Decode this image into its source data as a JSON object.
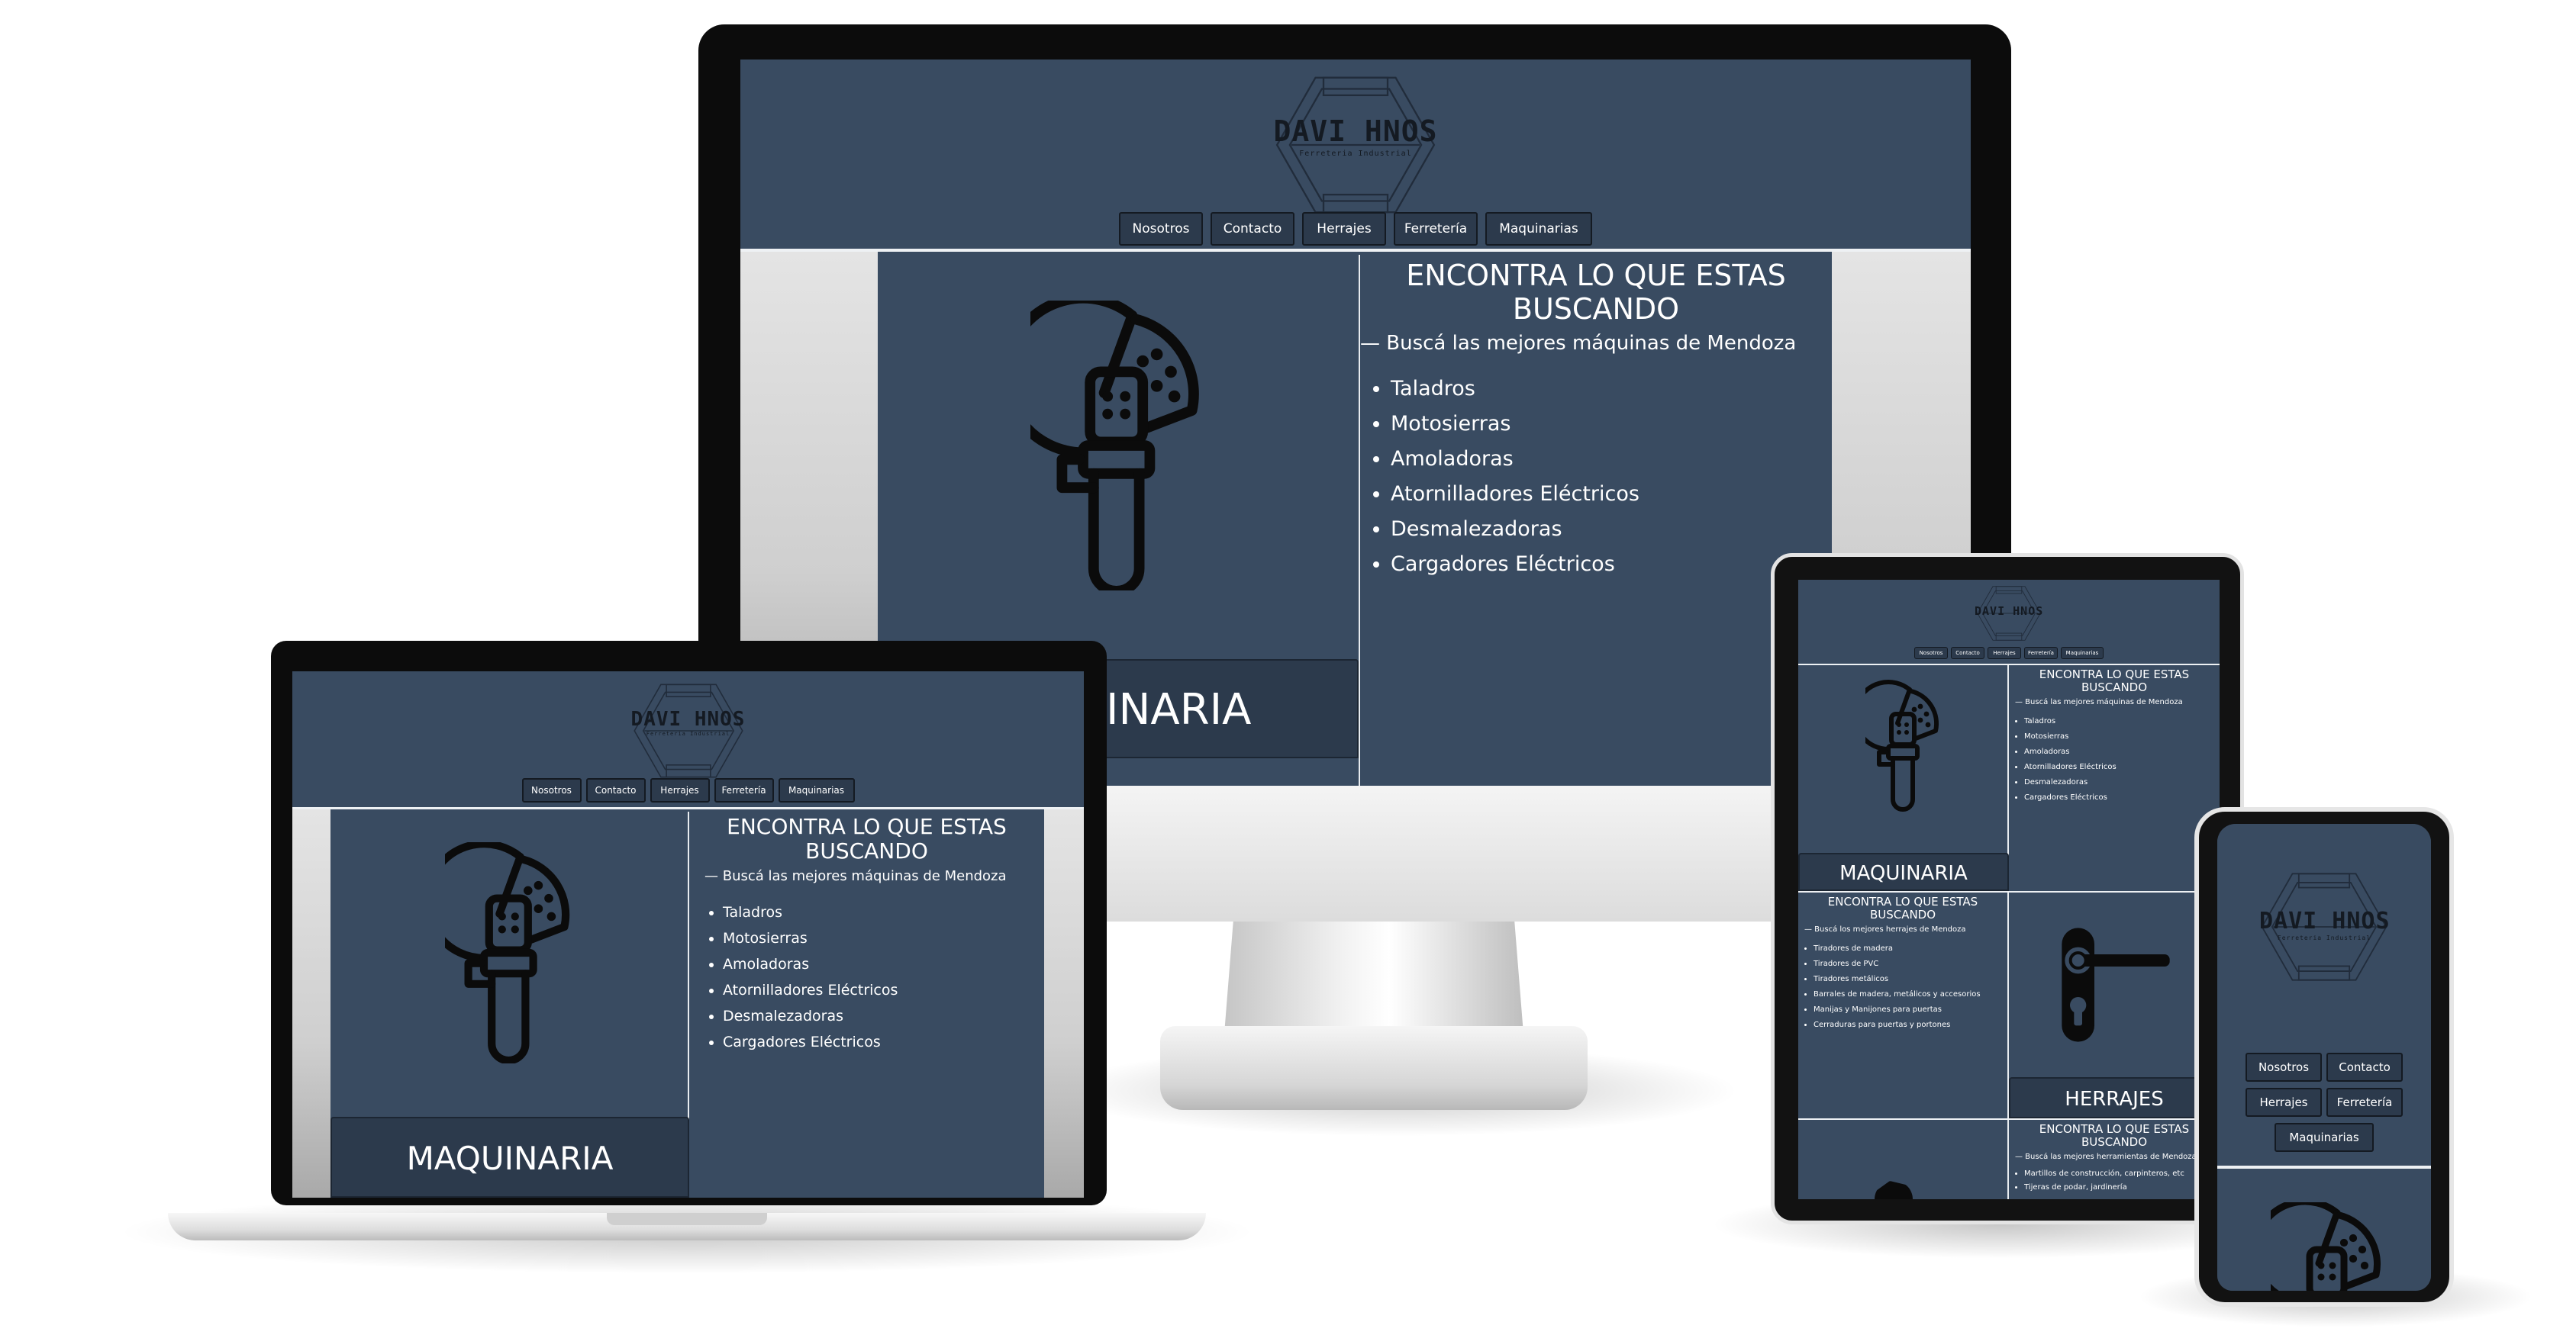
{
  "site": {
    "logo_title": "DAVI HNOS",
    "logo_subtitle": "Ferreteria Industrial",
    "nav": [
      "Nosotros",
      "Contacto",
      "Herrajes",
      "Ferretería",
      "Maquinarias"
    ]
  },
  "maquinaria": {
    "heading": "ENCONTRA LO QUE ESTAS BUSCANDO",
    "subheading": "— Buscá las mejores máquinas de Mendoza",
    "items": [
      "Taladros",
      "Motosierras",
      "Amoladoras",
      "Atornilladores Eléctricos",
      "Desmalezadoras",
      "Cargadores Eléctricos"
    ],
    "category": "MAQUINARIA",
    "category_partial": "UINARIA"
  },
  "herrajes": {
    "heading": "ENCONTRA LO QUE ESTAS BUSCANDO",
    "subheading": "— Buscá los mejores herrajes de Mendoza",
    "items": [
      "Tiradores de madera",
      "Tiradores de PVC",
      "Tiradores metálicos",
      "Barrales de madera, metálicos y accesorios",
      "Manijas y Manijones para puertas",
      "Cerraduras para puertas y portones"
    ],
    "category": "HERRAJES"
  },
  "ferreteria": {
    "heading": "ENCONTRA LO QUE ESTAS BUSCANDO",
    "subheading": "— Buscá las mejores herramientas de Mendoza",
    "items": [
      "Martillos de construcción, carpinteros, etc",
      "Tijeras de podar, jardinería"
    ]
  },
  "icons": {
    "maquinaria": "angle-grinder-icon",
    "herrajes": "door-handle-icon",
    "logo": "hexagon-logo-icon"
  },
  "colors": {
    "site_bg": "#394b61",
    "nav_bg": "#2c3a4c",
    "icon_ink": "#0b0b0b"
  }
}
